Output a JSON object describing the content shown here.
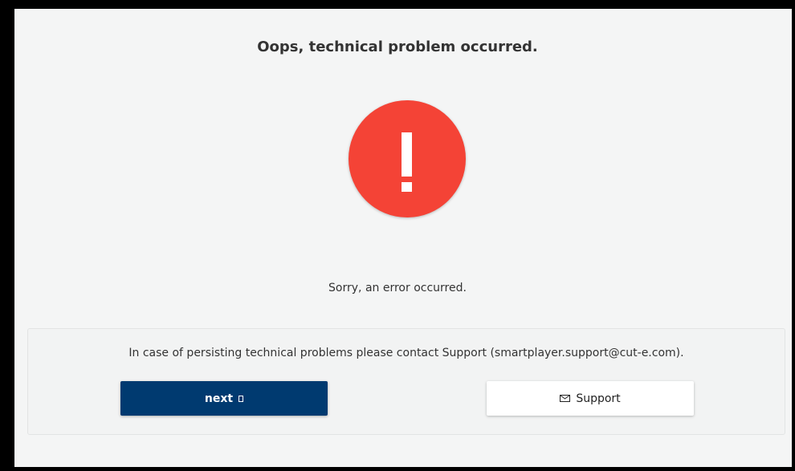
{
  "header": {
    "title": "Oops, technical problem occurred."
  },
  "error": {
    "icon": "error-exclamation-icon",
    "color": "#f44336",
    "message": "Sorry, an error occurred."
  },
  "support": {
    "text": "In case of persisting technical problems please contact Support (smartplayer.support@cut-e.com).",
    "next_label": "next",
    "next_icon": "next-square-icon",
    "next_color": "#003a70",
    "support_label": "Support",
    "support_icon": "mail-icon"
  }
}
